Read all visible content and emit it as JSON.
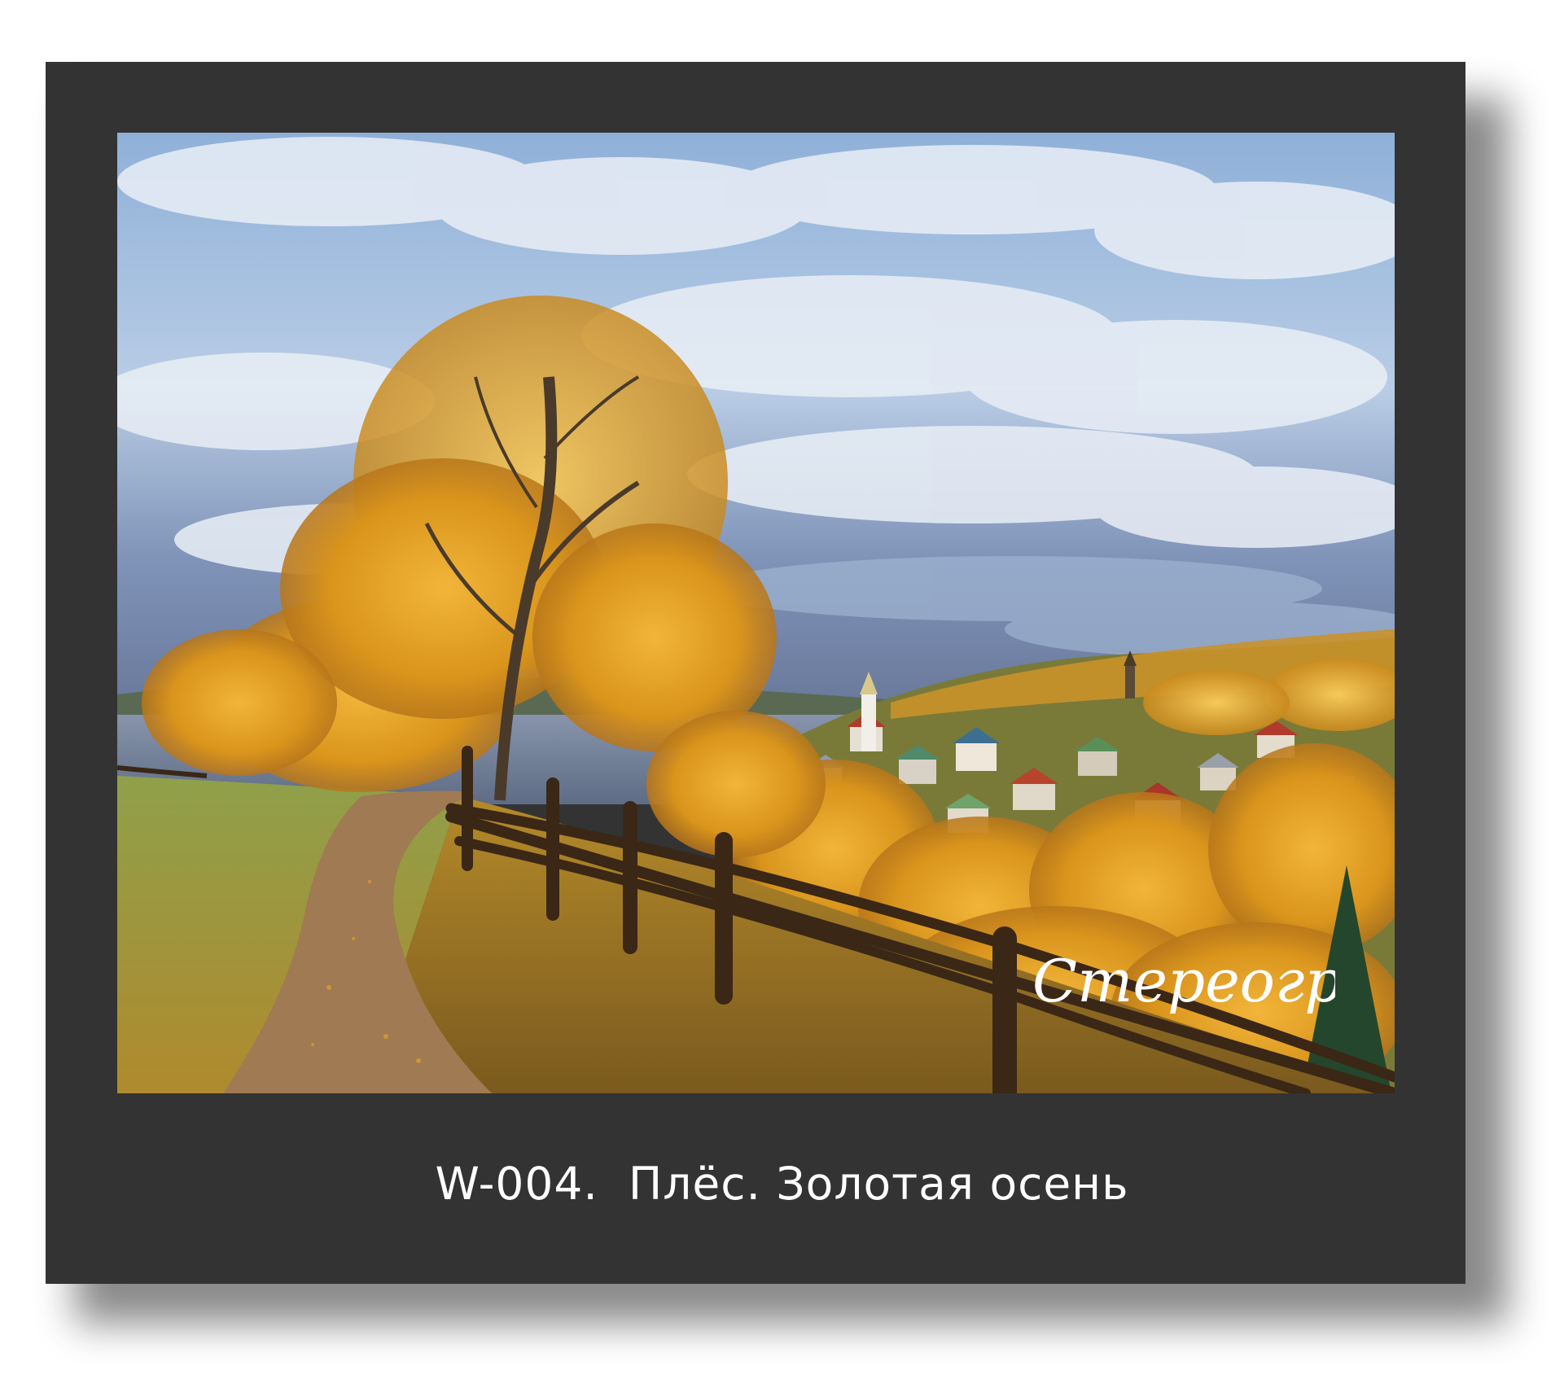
{
  "caption": {
    "text": "W-004.  Плёс. Золотая осень"
  },
  "watermark": {
    "text": "Стереоград"
  },
  "colors": {
    "card_background": "#333333",
    "caption_text": "#ffffff",
    "page_background": "#ffffff"
  },
  "photo": {
    "subject": "autumn landscape with birch trees, dirt path, wooden fence and riverside town"
  }
}
